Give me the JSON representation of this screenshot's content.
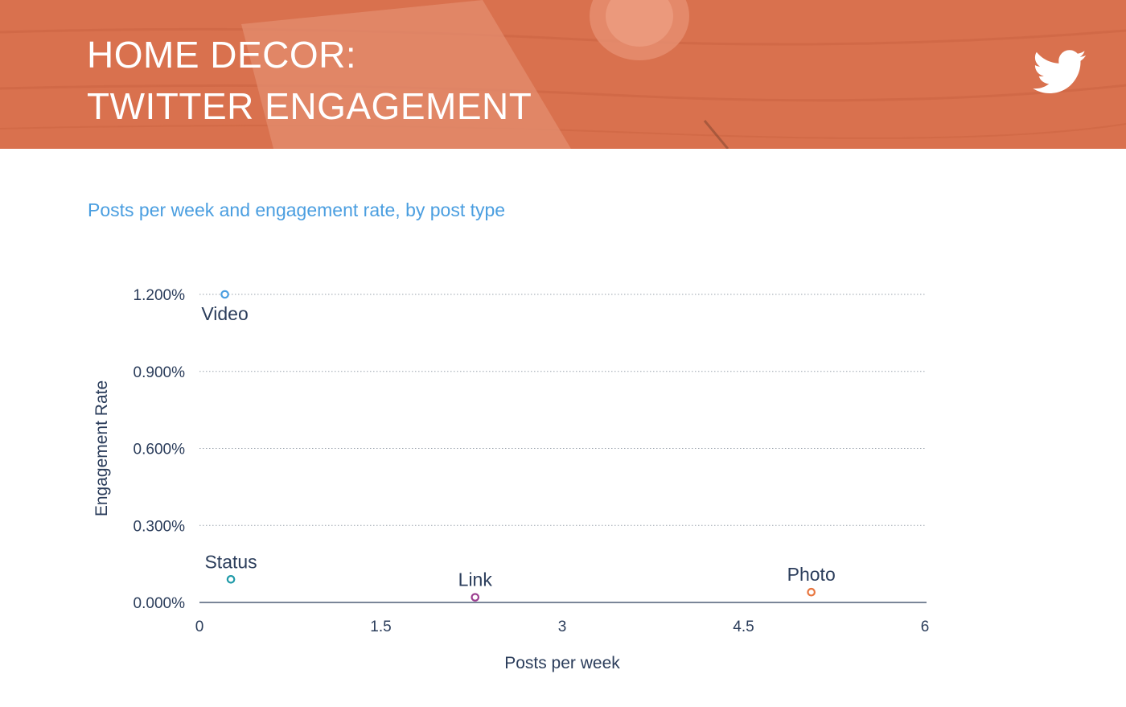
{
  "header": {
    "title_line1": "HOME DECOR:",
    "title_line2": "TWITTER ENGAGEMENT",
    "logo_icon": "twitter-bird-icon",
    "background_color": "#d9714e"
  },
  "subtitle": "Posts per week and engagement rate, by post type",
  "chart_data": {
    "type": "scatter",
    "title": "",
    "xlabel": "Posts per week",
    "ylabel": "Engagement Rate",
    "xlim": [
      0,
      6
    ],
    "ylim": [
      0,
      1.2
    ],
    "x_ticks": [
      0,
      1.5,
      3,
      4.5,
      6
    ],
    "x_tick_labels": [
      "0",
      "1.5",
      "3",
      "4.5",
      "6"
    ],
    "y_ticks": [
      0,
      0.3,
      0.6,
      0.9,
      1.2
    ],
    "y_tick_labels": [
      "0.000%",
      "0.300%",
      "0.600%",
      "0.900%",
      "1.200%"
    ],
    "grid": "horizontal dotted",
    "points": [
      {
        "label": "Video",
        "x": 0.21,
        "y": 1.2,
        "color": "#4a9ee0",
        "label_position": "below"
      },
      {
        "label": "Status",
        "x": 0.26,
        "y": 0.09,
        "color": "#1f9aa8",
        "label_position": "above"
      },
      {
        "label": "Link",
        "x": 2.28,
        "y": 0.02,
        "color": "#9b3d8f",
        "label_position": "above"
      },
      {
        "label": "Photo",
        "x": 5.06,
        "y": 0.04,
        "color": "#e8763f",
        "label_position": "above"
      }
    ]
  }
}
